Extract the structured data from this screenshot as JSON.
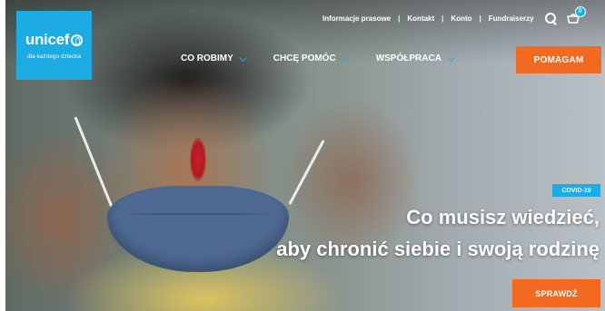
{
  "logo": {
    "wordmark": "unicef",
    "tagline": "dla każdego dziecka",
    "brand_color": "#1cabe2"
  },
  "utility_nav": {
    "items": [
      "Informacje prasowe",
      "Kontakt",
      "Konto",
      "Fundraiserzy"
    ],
    "separator": "|",
    "search_icon": "search-icon",
    "basket_icon": "basket-icon",
    "basket_count": "0"
  },
  "main_nav": {
    "items": [
      {
        "label": "CO ROBIMY"
      },
      {
        "label": "CHCĘ POMÓC"
      },
      {
        "label": "WSPÓŁPRACA"
      }
    ],
    "chevron_color": "#1cabe2"
  },
  "donate_button": {
    "label": "POMAGAM",
    "color": "#f26a21"
  },
  "hero": {
    "tag": "COVID-19",
    "headline_line1": "Co musisz wiedzieć,",
    "headline_line2": "aby chronić siebie i swoją rodzinę",
    "cta_label": "SPRAWDŹ"
  }
}
